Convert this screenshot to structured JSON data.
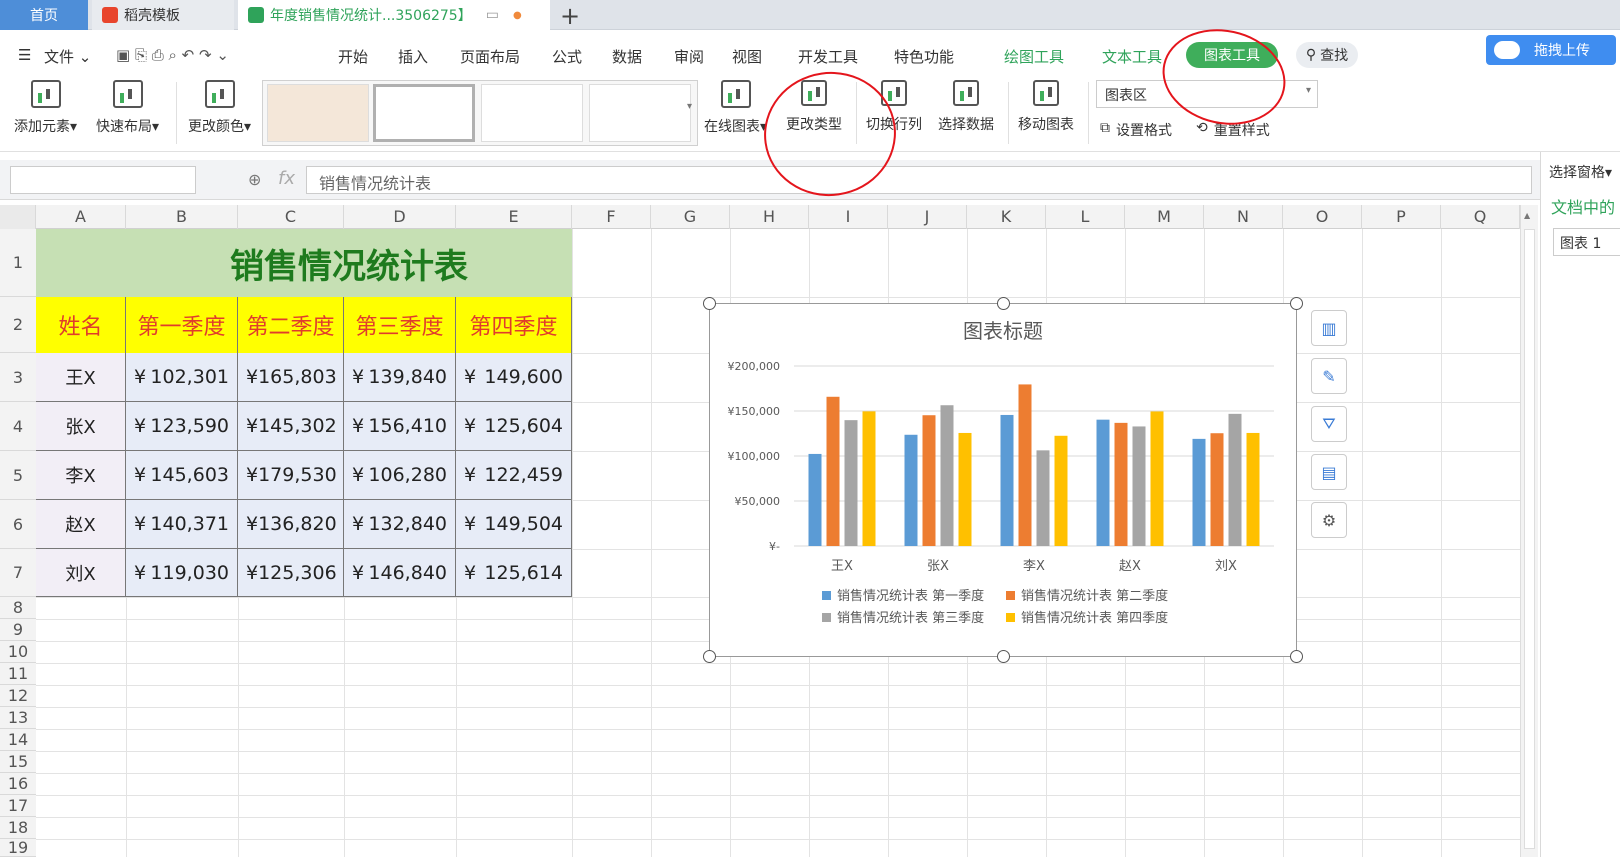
{
  "tabs": {
    "home": "首页",
    "docer": "稻壳模板",
    "doc": "年度销售情况统计...3506275】",
    "new": "+"
  },
  "menu": {
    "file": "文件",
    "items": [
      "开始",
      "插入",
      "页面布局",
      "公式",
      "数据",
      "审阅",
      "视图",
      "开发工具",
      "特色功能"
    ],
    "drawing_tools": "绘图工具",
    "text_tools": "文本工具",
    "chart_tools": "图表工具",
    "search": "查找",
    "upload": "拖拽上传"
  },
  "ribbon": {
    "add_element": "添加元素",
    "quick_layout": "快速布局",
    "change_color": "更改颜色",
    "online_chart": "在线图表",
    "change_type": "更改类型",
    "switch_rowcol": "切换行列",
    "select_data": "选择数据",
    "move_chart": "移动图表",
    "chart_area": "图表区",
    "set_format": "设置格式",
    "reset_style": "重置样式"
  },
  "formula": {
    "fx": "fx",
    "content": "销售情况统计表"
  },
  "grid": {
    "columns": [
      "A",
      "B",
      "C",
      "D",
      "E",
      "F",
      "G",
      "H",
      "I",
      "J",
      "K",
      "L",
      "M",
      "N",
      "O",
      "P",
      "Q"
    ],
    "rows": [
      "1",
      "2",
      "3",
      "4",
      "5",
      "6",
      "7",
      "8",
      "9",
      "10",
      "11",
      "12",
      "13",
      "14",
      "15",
      "16",
      "17",
      "18",
      "19"
    ]
  },
  "sheet": {
    "title": "销售情况统计表",
    "headers": [
      "姓名",
      "第一季度",
      "第二季度",
      "第三季度",
      "第四季度"
    ],
    "currency": "¥",
    "rows": [
      {
        "name": "王X",
        "q": [
          "102,301",
          "165,803",
          "139,840",
          "149,600"
        ]
      },
      {
        "name": "张X",
        "q": [
          "123,590",
          "145,302",
          "156,410",
          "125,604"
        ]
      },
      {
        "name": "李X",
        "q": [
          "145,603",
          "179,530",
          "106,280",
          "122,459"
        ]
      },
      {
        "name": "赵X",
        "q": [
          "140,371",
          "136,820",
          "132,840",
          "149,504"
        ]
      },
      {
        "name": "刘X",
        "q": [
          "119,030",
          "125,306",
          "146,840",
          "125,614"
        ]
      }
    ]
  },
  "chart_data": {
    "type": "bar",
    "title": "图表标题",
    "categories": [
      "王X",
      "张X",
      "李X",
      "赵X",
      "刘X"
    ],
    "series": [
      {
        "name": "销售情况统计表 第一季度",
        "color": "#5b9bd5",
        "values": [
          102301,
          123590,
          145603,
          140371,
          119030
        ]
      },
      {
        "name": "销售情况统计表 第二季度",
        "color": "#ed7d31",
        "values": [
          165803,
          145302,
          179530,
          136820,
          125306
        ]
      },
      {
        "name": "销售情况统计表 第三季度",
        "color": "#a5a5a5",
        "values": [
          139840,
          156410,
          106280,
          132840,
          146840
        ]
      },
      {
        "name": "销售情况统计表 第四季度",
        "color": "#ffc000",
        "values": [
          149600,
          125604,
          122459,
          149504,
          125614
        ]
      }
    ],
    "yticks": [
      "¥-",
      "¥50,000",
      "¥100,000",
      "¥150,000",
      "¥200,000"
    ],
    "ylim": [
      0,
      200000
    ],
    "legend": "bottom",
    "grid": true
  },
  "right_panel": {
    "title": "选择窗格",
    "doc_label": "文档中的",
    "item": "图表 1"
  }
}
